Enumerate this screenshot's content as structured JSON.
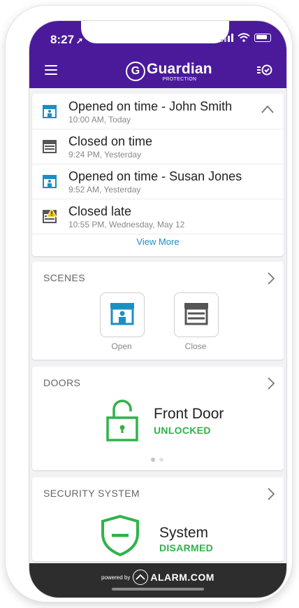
{
  "status_bar": {
    "time": "8:27",
    "location_glyph": "➚"
  },
  "header": {
    "logo_letter": "G",
    "brand_name": "Guardian",
    "brand_sub": "PROTECTION",
    "menu_icon": "hamburger-menu-icon",
    "tasks_icon": "checklist-icon"
  },
  "activity": {
    "events": [
      {
        "title": "Opened on time - John Smith",
        "time": "10:00 AM, Today",
        "icon": "store-open-icon"
      },
      {
        "title": "Closed on time",
        "time": "9:24 PM, Yesterday",
        "icon": "store-closed-icon"
      },
      {
        "title": "Opened on time - Susan Jones",
        "time": "9:52 AM, Yesterday",
        "icon": "store-open-icon"
      },
      {
        "title": "Closed late",
        "time": "10:55 PM, Wednesday, May 12",
        "icon": "store-closed-warning-icon"
      }
    ],
    "view_more": "View More"
  },
  "scenes": {
    "title": "SCENES",
    "items": [
      {
        "label": "Open",
        "icon": "store-open-icon"
      },
      {
        "label": "Close",
        "icon": "store-closed-icon"
      }
    ]
  },
  "doors": {
    "title": "DOORS",
    "device": "Front Door",
    "state": "UNLOCKED",
    "page_count": 2,
    "active_page": 1
  },
  "security": {
    "title": "SECURITY SYSTEM",
    "device": "System",
    "state": "DISARMED"
  },
  "footer": {
    "powered_by": "powered by",
    "brand": "ALARM.COM"
  },
  "colors": {
    "header_bg": "#4a1a9a",
    "accent_blue": "#1b8fc4",
    "status_green": "#2fb34a",
    "warning_yellow": "#f2c200",
    "footer_bg": "#2d2d2d"
  }
}
